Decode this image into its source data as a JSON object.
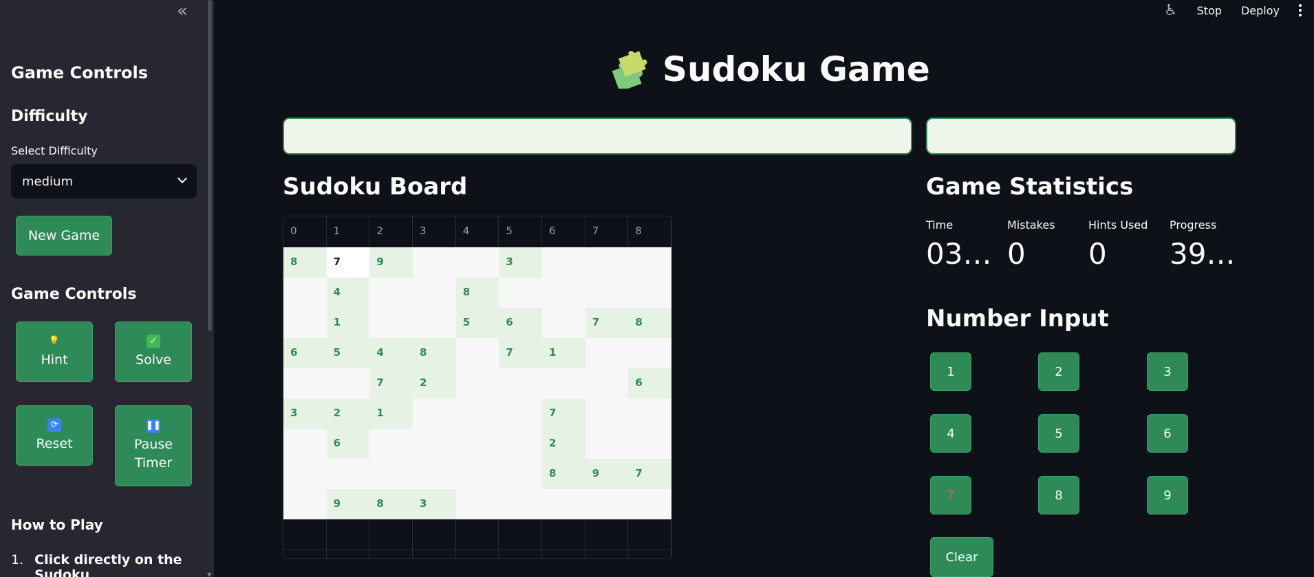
{
  "topbar": {
    "stop": "Stop",
    "deploy": "Deploy"
  },
  "sidebar": {
    "collapse": "«",
    "heading": "Game Controls",
    "difficulty_heading": "Difficulty",
    "select_label": "Select Difficulty",
    "select_value": "medium",
    "new_game": "New Game",
    "controls_heading": "Game Controls",
    "hint": "Hint",
    "solve": "Solve",
    "reset": "Reset",
    "pause": "Pause Timer",
    "how_to_play": "How to Play",
    "instruction_1_num": "1.",
    "instruction_1": "Click directly on the Sudoku"
  },
  "main": {
    "title": "Sudoku Game",
    "board_heading": "Sudoku Board",
    "board_columns": [
      "0",
      "1",
      "2",
      "3",
      "4",
      "5",
      "6",
      "7",
      "8"
    ],
    "stats_heading": "Game Statistics",
    "stats": {
      "time_label": "Time",
      "time_value": "03…",
      "mistakes_label": "Mistakes",
      "mistakes_value": "0",
      "hints_label": "Hints Used",
      "hints_value": "0",
      "progress_label": "Progress",
      "progress_value": "39…"
    },
    "number_input_heading": "Number Input",
    "numbers": [
      "1",
      "2",
      "3",
      "4",
      "5",
      "6",
      "7",
      "8",
      "9"
    ],
    "clear": "Clear"
  },
  "board": [
    [
      "8",
      "7",
      "9",
      "",
      "",
      "3",
      "",
      "",
      ""
    ],
    [
      "",
      "4",
      "",
      "",
      "8",
      "",
      "",
      "",
      ""
    ],
    [
      "",
      "1",
      "",
      "",
      "5",
      "6",
      "",
      "7",
      "8"
    ],
    [
      "6",
      "5",
      "4",
      "8",
      "",
      "7",
      "1",
      "",
      ""
    ],
    [
      "",
      "",
      "7",
      "2",
      "",
      "",
      "",
      "",
      "6"
    ],
    [
      "3",
      "2",
      "1",
      "",
      "",
      "",
      "7",
      "",
      ""
    ],
    [
      "",
      "6",
      "",
      "",
      "",
      "",
      "2",
      "",
      ""
    ],
    [
      "",
      "",
      "",
      "",
      "",
      "",
      "8",
      "9",
      "7"
    ],
    [
      "",
      "9",
      "8",
      "3",
      "",
      "",
      "",
      "",
      ""
    ]
  ],
  "colors": {
    "accent": "#2e8b57",
    "background": "#0e1117",
    "sidebar": "#262730",
    "highlight_number": "#e05a4b"
  }
}
